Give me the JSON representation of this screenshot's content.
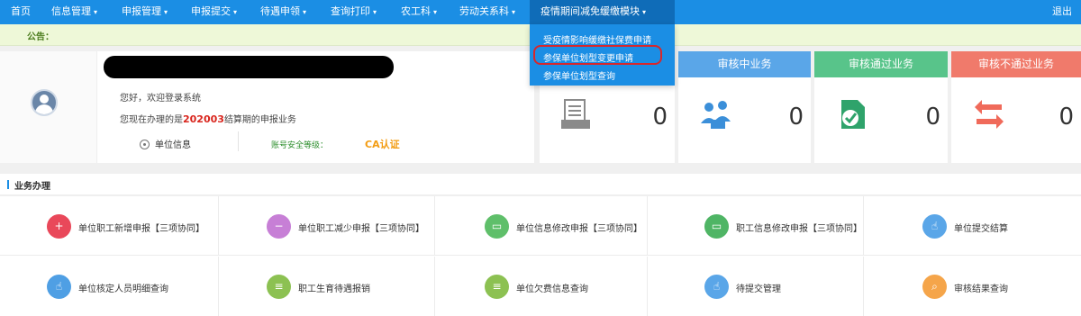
{
  "topnav": {
    "items": [
      {
        "label": "首页",
        "caret": ""
      },
      {
        "label": "信息管理",
        "caret": "▾"
      },
      {
        "label": "申报管理",
        "caret": "▾"
      },
      {
        "label": "申报提交",
        "caret": "▾"
      },
      {
        "label": "待遇申领",
        "caret": "▾"
      },
      {
        "label": "查询打印",
        "caret": "▾"
      },
      {
        "label": "农工科",
        "caret": "▾"
      },
      {
        "label": "劳动关系科",
        "caret": "▾"
      },
      {
        "label": "疫情期间减免缓缴模块",
        "caret": "▾"
      }
    ],
    "logout": "退出",
    "bg_color": "#1b8ee4"
  },
  "notice": {
    "label": "公告："
  },
  "dropdown": {
    "items": [
      "受疫情影响缓缴社保费申请",
      "参保单位划型变更申请",
      "参保单位划型查询"
    ],
    "highlighted_index": 1
  },
  "user": {
    "welcome": "您好，欢迎登录系统",
    "period_prefix": "您现在办理的是",
    "period": "202003",
    "period_suffix": "结算期的申报业务",
    "unit_info": "单位信息",
    "security_label": "账号安全等级：",
    "ca_label": "CA认证"
  },
  "stats": [
    {
      "title": "",
      "value": "0",
      "color": "#ffffff",
      "icon": "document-icon"
    },
    {
      "title": "审核中业务",
      "value": "0",
      "color": "#5aa6e8",
      "icon": "users-icon"
    },
    {
      "title": "审核通过业务",
      "value": "0",
      "color": "#58c48a",
      "icon": "check-file-icon"
    },
    {
      "title": "审核不通过业务",
      "value": "0",
      "color": "#f07a6b",
      "icon": "return-arrows-icon"
    }
  ],
  "business": {
    "title": "业务办理",
    "tiles": [
      {
        "label": "单位职工新增申报【三项协同】",
        "color": "#e9485a",
        "icon": "add-user-icon",
        "glyph": "+"
      },
      {
        "label": "单位职工减少申报【三项协同】",
        "color": "#c77fd6",
        "icon": "remove-user-icon",
        "glyph": "−"
      },
      {
        "label": "单位信息修改申报【三项协同】",
        "color": "#5fbf6a",
        "icon": "id-card-icon",
        "glyph": "▭"
      },
      {
        "label": "职工信息修改申报【三项协同】",
        "color": "#4fb565",
        "icon": "id-card-icon",
        "glyph": "▭"
      },
      {
        "label": "单位提交结算",
        "color": "#5aa6e8",
        "icon": "hand-pointer-icon",
        "glyph": "☝"
      },
      {
        "label": "单位核定人员明细查询",
        "color": "#4f9fe4",
        "icon": "hand-pointer-icon",
        "glyph": "☝"
      },
      {
        "label": "职工生育待遇报销",
        "color": "#8cc152",
        "icon": "document-icon",
        "glyph": "≡"
      },
      {
        "label": "单位欠费信息查询",
        "color": "#8cc152",
        "icon": "document-icon",
        "glyph": "≡"
      },
      {
        "label": "待提交管理",
        "color": "#5aa6e8",
        "icon": "hand-pointer-icon",
        "glyph": "☝"
      },
      {
        "label": "审核结果查询",
        "color": "#f5a54a",
        "icon": "search-icon",
        "glyph": "⌕"
      }
    ]
  }
}
